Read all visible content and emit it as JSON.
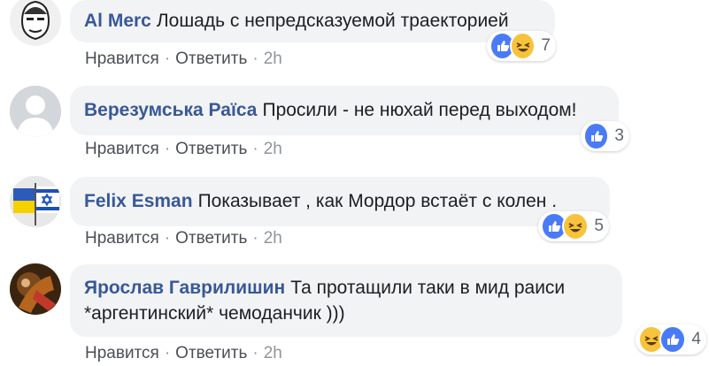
{
  "comments": [
    {
      "author": "Al Merc",
      "text": "Лошадь с непредсказуемой траекторией",
      "actions": {
        "like": "Нравится",
        "reply": "Ответить",
        "time": "2h"
      },
      "reaction_count": "7",
      "reactions": [
        "like-icon",
        "haha-icon"
      ]
    },
    {
      "author": "Верезумська Раїса",
      "text": "Просили - не нюхай перед выходом!",
      "actions": {
        "like": "Нравится",
        "reply": "Ответить",
        "time": "2h"
      },
      "reaction_count": "3",
      "reactions": [
        "like-icon"
      ]
    },
    {
      "author": "Felix Esman",
      "text": "Показывает , как Мордор встаёт с колен .",
      "actions": {
        "like": "Нравится",
        "reply": "Ответить",
        "time": "2h"
      },
      "reaction_count": "5",
      "reactions": [
        "like-icon",
        "haha-icon"
      ]
    },
    {
      "author": "Ярослав Гаврилишин",
      "text_line1": "Та протащили таки в мид раиси",
      "text_line2": "*аргентинский* чемоданчик )))",
      "actions": {
        "like": "Нравится",
        "reply": "Ответить",
        "time": "2h"
      },
      "reaction_count": "4",
      "reactions": [
        "haha-icon",
        "like-icon"
      ]
    }
  ],
  "separator": "·",
  "colors": {
    "author": "#385898",
    "bubble": "#f2f3f5",
    "like": "#4a7bf7",
    "haha": "#f7c33c"
  }
}
